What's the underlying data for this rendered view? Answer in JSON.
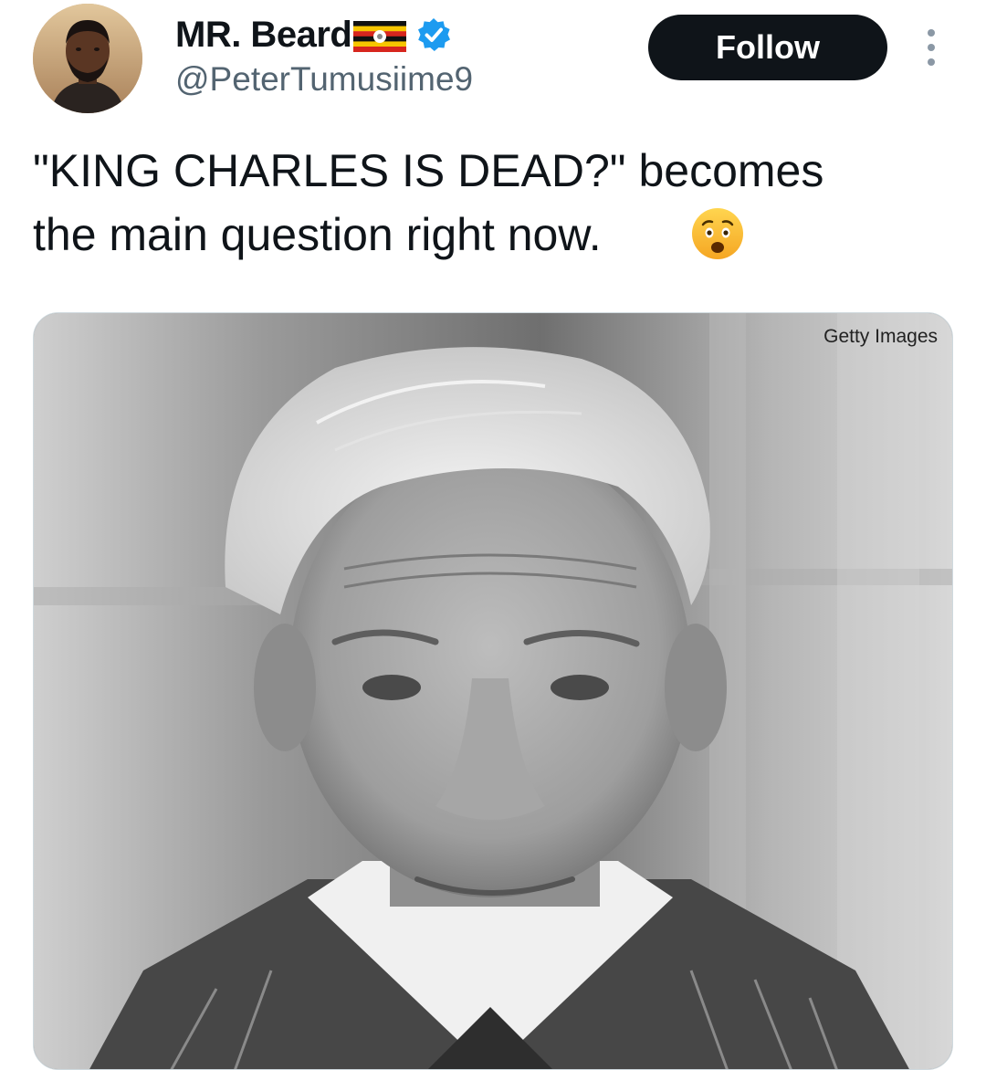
{
  "author": {
    "display_name": "MR. Beard",
    "handle": "@PeterTumusiime9",
    "verified": true,
    "flag_icon": "uganda-flag-icon",
    "avatar_icon": "profile-avatar"
  },
  "actions": {
    "follow_label": "Follow",
    "more_icon": "more-vertical-icon"
  },
  "tweet": {
    "text": "\"KING CHARLES IS DEAD?\" becomes\nthe main question right now.",
    "emoji": "anxious-face-emoji-icon"
  },
  "media": {
    "credit": "Getty Images",
    "description_icon": "black-and-white-portrait-photo"
  },
  "colors": {
    "text_primary": "#0f1419",
    "text_secondary": "#536471",
    "follow_bg": "#0f1419",
    "verified_blue": "#1d9bf0"
  }
}
